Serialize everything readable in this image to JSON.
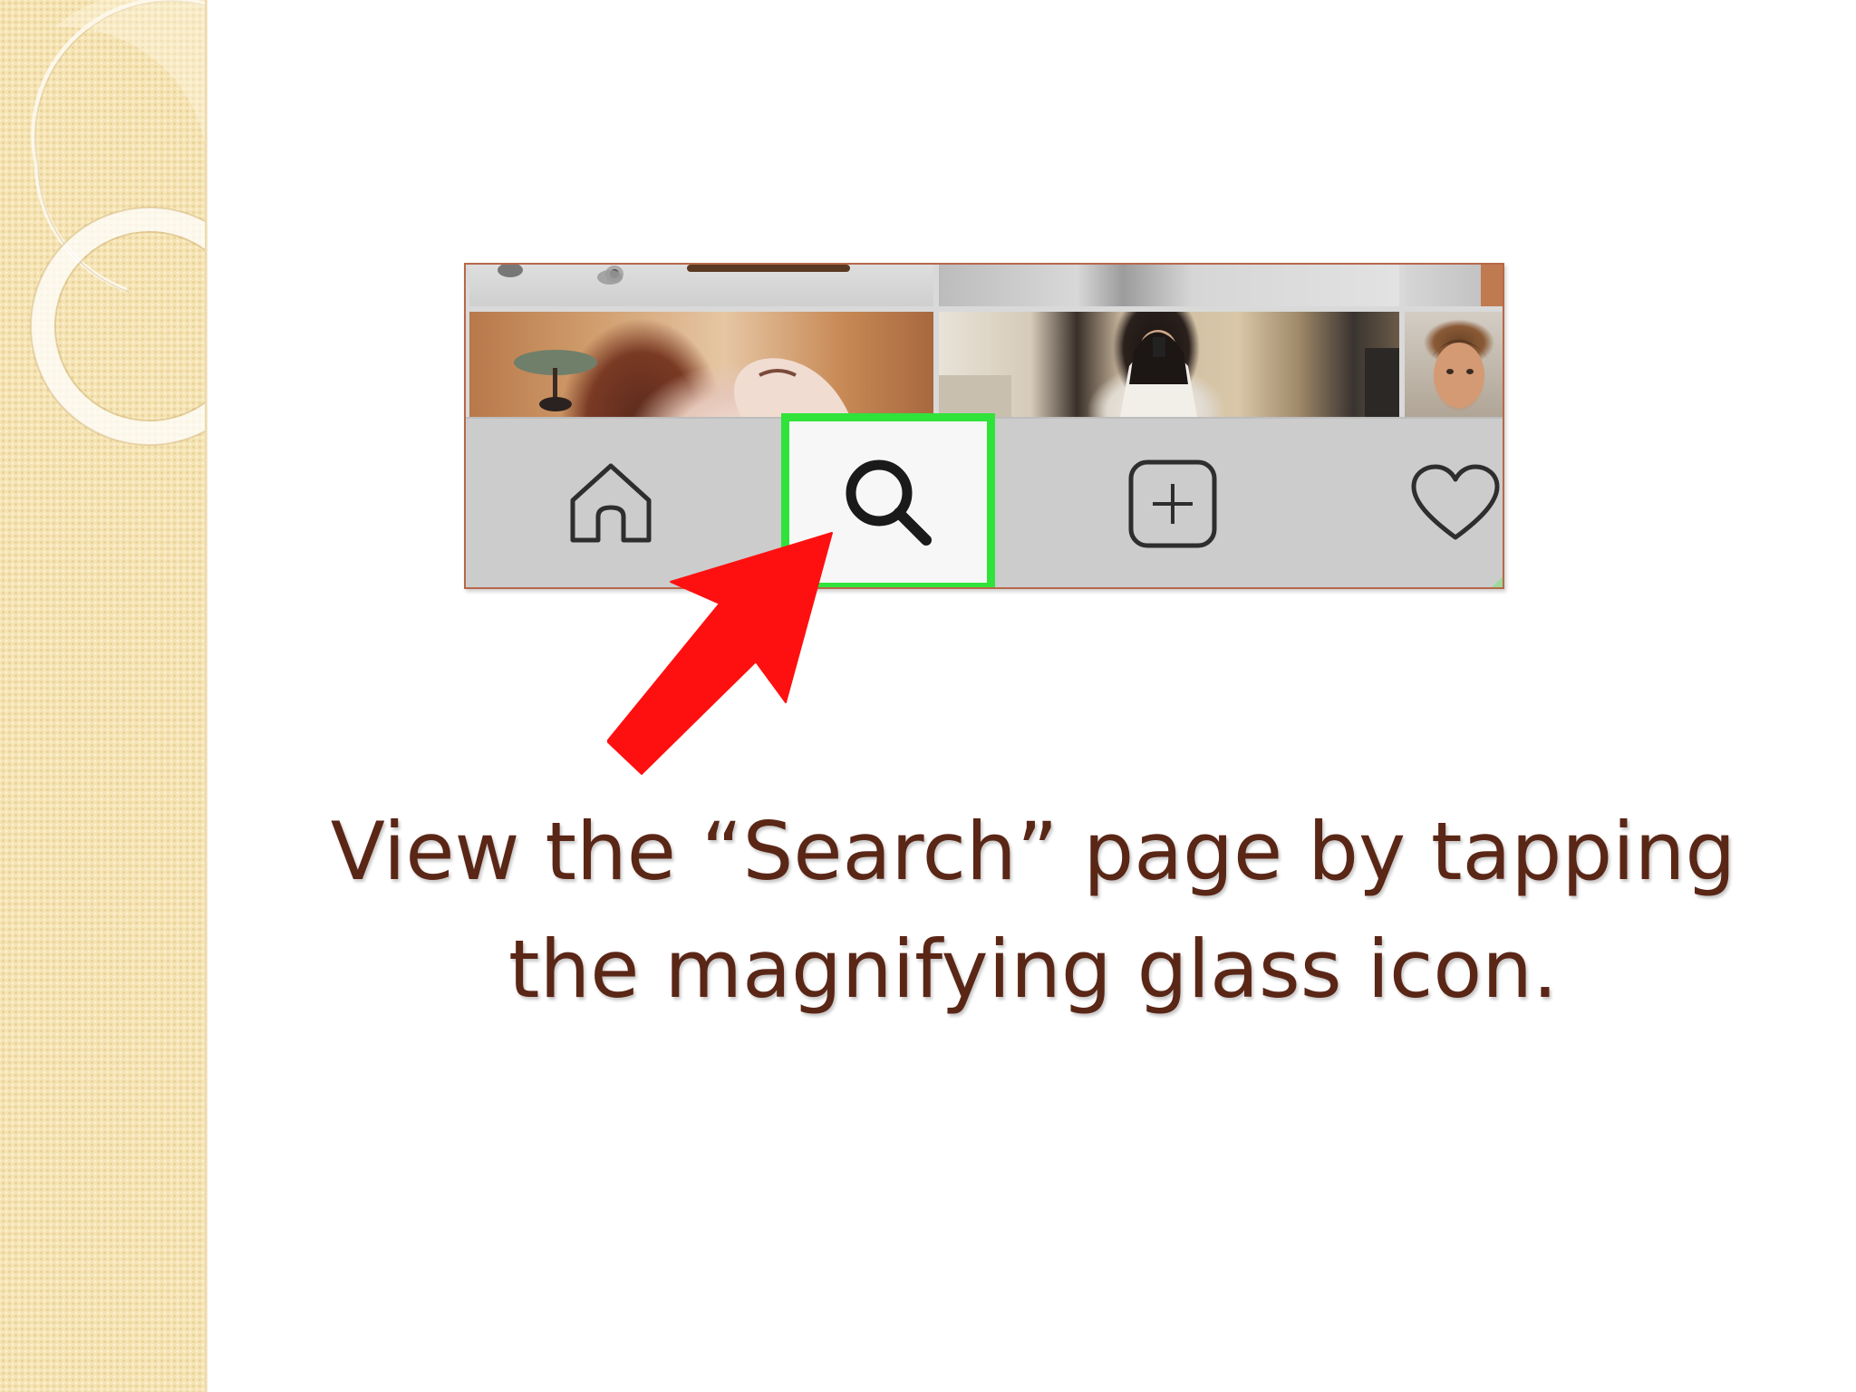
{
  "slide": {
    "caption_line1": "View the “Search” page by tapping",
    "caption_line2": "the magnifying glass icon."
  },
  "app_tab_bar": {
    "tabs": [
      {
        "name": "home",
        "icon": "home-icon",
        "selected": false
      },
      {
        "name": "search",
        "icon": "search-icon",
        "selected": true
      },
      {
        "name": "new-post",
        "icon": "add-square-icon",
        "selected": false
      },
      {
        "name": "activity",
        "icon": "heart-icon",
        "selected": false
      }
    ]
  },
  "colors": {
    "caption_text": "#5a2616",
    "highlight_box": "#2fe33a",
    "arrow": "#ff1010",
    "card_border": "#b8684a",
    "side_band": "#f5e3b3"
  }
}
